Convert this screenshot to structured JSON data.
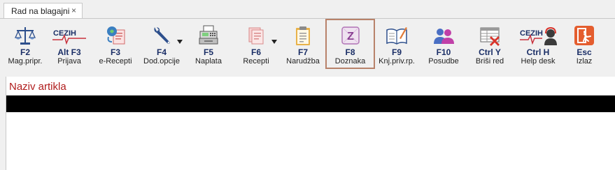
{
  "tab": {
    "title": "Rad na blagajni",
    "close_glyph": "×"
  },
  "toolbar": {
    "buttons": [
      {
        "key": "F2",
        "label": "Mag.pripr.",
        "icon": "scales-icon"
      },
      {
        "key": "Alt F3",
        "label": "Prijava",
        "icon": "cezih-logo-icon",
        "icon_text": "CEZIH"
      },
      {
        "key": "F3",
        "label": "e-Recepti",
        "icon": "e-prescription-icon"
      },
      {
        "key": "F4",
        "label": "Dod.opcije",
        "icon": "wrench-icon"
      },
      {
        "key": "F5",
        "label": "Naplata",
        "icon": "cash-register-icon"
      },
      {
        "key": "F6",
        "label": "Recepti",
        "icon": "prescriptions-icon"
      },
      {
        "key": "F7",
        "label": "Narudžba",
        "icon": "clipboard-icon"
      },
      {
        "key": "F8",
        "label": "Doznaka",
        "icon": "doznaka-icon",
        "icon_text": "Z"
      },
      {
        "key": "F9",
        "label": "Knj.priv.rp.",
        "icon": "book-icon"
      },
      {
        "key": "F10",
        "label": "Posudbe",
        "icon": "users-icon"
      },
      {
        "key": "Ctrl Y",
        "label": "Briši red",
        "icon": "delete-row-icon"
      },
      {
        "key": "Ctrl H",
        "label": "Help desk",
        "icon": "cezih-helpdesk-icon",
        "icon_text": "CEZIH"
      },
      {
        "key": "Esc",
        "label": "Izlaz",
        "icon": "exit-icon"
      }
    ]
  },
  "content": {
    "title": "Naziv artikla"
  },
  "colors": {
    "accent_active_border": "#b8826a",
    "title_red": "#b01c1c",
    "key_blue": "#1a2e66"
  }
}
